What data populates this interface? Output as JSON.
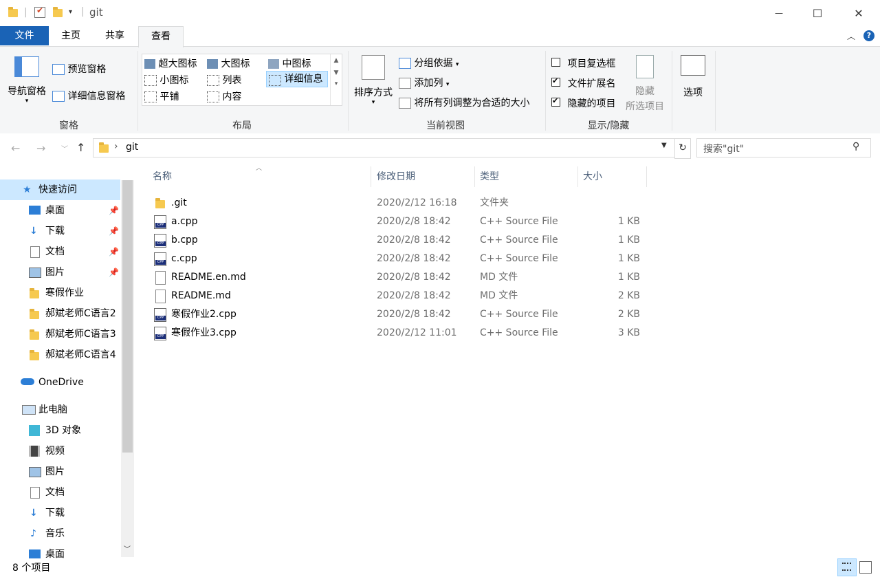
{
  "window": {
    "title": "git",
    "minimize": "—",
    "maximize": "☐",
    "close": "✕"
  },
  "ribbon_tabs": [
    {
      "label": "文件"
    },
    {
      "label": "主页"
    },
    {
      "label": "共享"
    },
    {
      "label": "查看"
    }
  ],
  "ribbon": {
    "pane_group": {
      "nav_pane": "导航窗格",
      "preview_pane": "预览窗格",
      "details_pane": "详细信息窗格",
      "label": "窗格"
    },
    "layout_group": {
      "items": [
        "超大图标",
        "大图标",
        "中图标",
        "小图标",
        "列表",
        "详细信息",
        "平铺",
        "内容"
      ],
      "label": "布局"
    },
    "view_group": {
      "sort_by": "排序方式",
      "group_by": "分组依据",
      "add_columns": "添加列",
      "size_all_columns": "将所有列调整为合适的大小",
      "label": "当前视图"
    },
    "show_hide_group": {
      "item_checkboxes": "项目复选框",
      "file_ext": "文件扩展名",
      "hidden_items": "隐藏的项目",
      "hide_selected_1": "隐藏",
      "hide_selected_2": "所选项目",
      "label": "显示/隐藏",
      "item_checkboxes_checked": false,
      "file_ext_checked": true,
      "hidden_items_checked": true
    },
    "options": "选项"
  },
  "address": {
    "breadcrumb": "git",
    "search_placeholder": "搜索\"git\""
  },
  "nav": {
    "quick_access": "快速访问",
    "quick_items": [
      "桌面",
      "下载",
      "文档",
      "图片",
      "寒假作业",
      "郝斌老师C语言2",
      "郝斌老师C语言3",
      "郝斌老师C语言4"
    ],
    "onedrive": "OneDrive",
    "this_pc": "此电脑",
    "pc_items": [
      "3D 对象",
      "视频",
      "图片",
      "文档",
      "下载",
      "音乐",
      "桌面"
    ]
  },
  "columns": {
    "name": "名称",
    "date": "修改日期",
    "type": "类型",
    "size": "大小"
  },
  "files": [
    {
      "name": ".git",
      "date": "2020/2/12 16:18",
      "type": "文件夹",
      "size": "",
      "kind": "folder"
    },
    {
      "name": "a.cpp",
      "date": "2020/2/8 18:42",
      "type": "C++ Source File",
      "size": "1 KB",
      "kind": "cpp"
    },
    {
      "name": "b.cpp",
      "date": "2020/2/8 18:42",
      "type": "C++ Source File",
      "size": "1 KB",
      "kind": "cpp"
    },
    {
      "name": "c.cpp",
      "date": "2020/2/8 18:42",
      "type": "C++ Source File",
      "size": "1 KB",
      "kind": "cpp"
    },
    {
      "name": "README.en.md",
      "date": "2020/2/8 18:42",
      "type": "MD 文件",
      "size": "1 KB",
      "kind": "md"
    },
    {
      "name": "README.md",
      "date": "2020/2/8 18:42",
      "type": "MD 文件",
      "size": "2 KB",
      "kind": "md"
    },
    {
      "name": "寒假作业2.cpp",
      "date": "2020/2/8 18:42",
      "type": "C++ Source File",
      "size": "2 KB",
      "kind": "cpp"
    },
    {
      "name": "寒假作业3.cpp",
      "date": "2020/2/12 11:01",
      "type": "C++ Source File",
      "size": "3 KB",
      "kind": "cpp"
    }
  ],
  "status": {
    "count": "8 个项目"
  },
  "colors": {
    "accent": "#1a63b6",
    "selection": "#cce8ff",
    "folder": "#f6c94f"
  }
}
